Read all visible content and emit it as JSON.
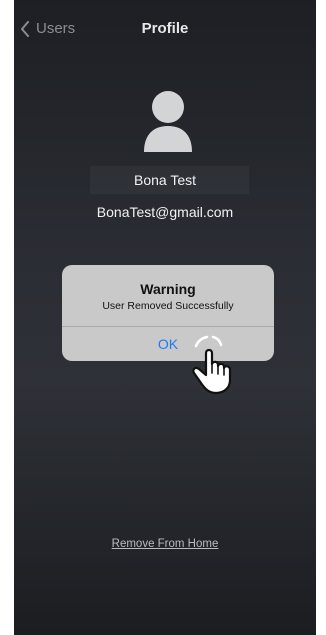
{
  "header": {
    "back_label": "Users",
    "title": "Profile"
  },
  "profile": {
    "name": "Bona Test",
    "email": "BonaTest@gmail.com",
    "avatar_icon": "user-avatar-icon"
  },
  "alert": {
    "title": "Warning",
    "message": "User Removed Successfully",
    "ok_label": "OK"
  },
  "actions": {
    "remove_label": "Remove From Home"
  },
  "icons": {
    "back": "chevron-left-icon",
    "pointer": "tap-hand-icon"
  },
  "colors": {
    "accent": "#1f7bf2",
    "background": "#2a2d33"
  }
}
